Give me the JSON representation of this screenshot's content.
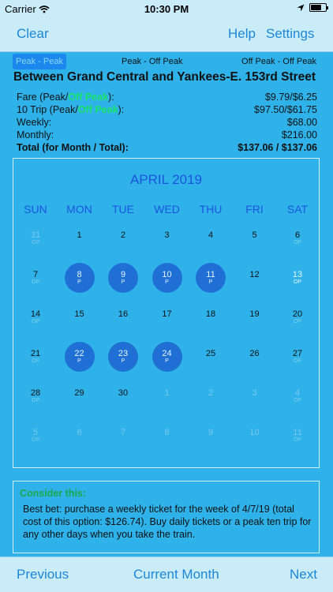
{
  "status": {
    "carrier": "Carrier",
    "time": "10:30 PM",
    "battery_level": 0.7
  },
  "nav": {
    "clear": "Clear",
    "help": "Help",
    "settings": "Settings"
  },
  "peak_options": [
    "Peak - Peak",
    "Peak - Off Peak",
    "Off Peak - Off Peak"
  ],
  "route": "Between Grand Central and Yankees-E. 153rd Street",
  "fares": {
    "fare": {
      "prefix": "Fare (Peak/",
      "offpeak": "Off Peak",
      "suffix": "):",
      "value": "$9.79/$6.25"
    },
    "ten_trip": {
      "prefix": "10 Trip (Peak/",
      "offpeak": "Off Peak",
      "suffix": "):",
      "value": "$97.50/$61.75"
    },
    "weekly": {
      "label": "Weekly:",
      "value": "$68.00"
    },
    "monthly": {
      "label": "Monthly:",
      "value": "$216.00"
    },
    "total": {
      "label": "Total (for Month / Total):",
      "value": "$137.06 / $137.06"
    }
  },
  "calendar": {
    "month": "APRIL 2019",
    "dow": [
      "SUN",
      "MON",
      "TUE",
      "WED",
      "THU",
      "FRI",
      "SAT"
    ],
    "weeks": [
      [
        {
          "n": "31",
          "s": "OP",
          "dim": true
        },
        {
          "n": "1"
        },
        {
          "n": "2"
        },
        {
          "n": "3"
        },
        {
          "n": "4"
        },
        {
          "n": "5"
        },
        {
          "n": "6",
          "s": "OP"
        }
      ],
      [
        {
          "n": "7",
          "s": "OP"
        },
        {
          "n": "8",
          "s": "P",
          "sel": true
        },
        {
          "n": "9",
          "s": "P",
          "sel": true
        },
        {
          "n": "10",
          "s": "P",
          "sel": true
        },
        {
          "n": "11",
          "s": "P",
          "sel": true
        },
        {
          "n": "12"
        },
        {
          "n": "13",
          "s": "OP",
          "hl": true
        }
      ],
      [
        {
          "n": "14",
          "s": "OP"
        },
        {
          "n": "15"
        },
        {
          "n": "16"
        },
        {
          "n": "17"
        },
        {
          "n": "18"
        },
        {
          "n": "19"
        },
        {
          "n": "20",
          "s": "OP"
        }
      ],
      [
        {
          "n": "21",
          "s": "OP"
        },
        {
          "n": "22",
          "s": "P",
          "sel": true
        },
        {
          "n": "23",
          "s": "P",
          "sel": true
        },
        {
          "n": "24",
          "s": "P",
          "sel": true
        },
        {
          "n": "25"
        },
        {
          "n": "26"
        },
        {
          "n": "27",
          "s": "OP"
        }
      ],
      [
        {
          "n": "28",
          "s": "OP"
        },
        {
          "n": "29"
        },
        {
          "n": "30"
        },
        {
          "n": "1",
          "dim": true
        },
        {
          "n": "2",
          "dim": true
        },
        {
          "n": "3",
          "dim": true
        },
        {
          "n": "4",
          "s": "OP",
          "dim": true
        }
      ],
      [
        {
          "n": "5",
          "s": "OP",
          "dim": true
        },
        {
          "n": "6",
          "dim": true
        },
        {
          "n": "7",
          "dim": true
        },
        {
          "n": "8",
          "dim": true
        },
        {
          "n": "9",
          "dim": true
        },
        {
          "n": "10",
          "dim": true
        },
        {
          "n": "11",
          "s": "OP",
          "dim": true
        }
      ]
    ]
  },
  "advice": {
    "title": "Consider this:",
    "text": "Best bet:  purchase a weekly ticket for the week of 4/7/19 (total cost of this option:  $126.74). Buy daily tickets or a peak ten trip for any other days when you take the train."
  },
  "bottom": {
    "previous": "Previous",
    "current": "Current Month",
    "next": "Next"
  }
}
